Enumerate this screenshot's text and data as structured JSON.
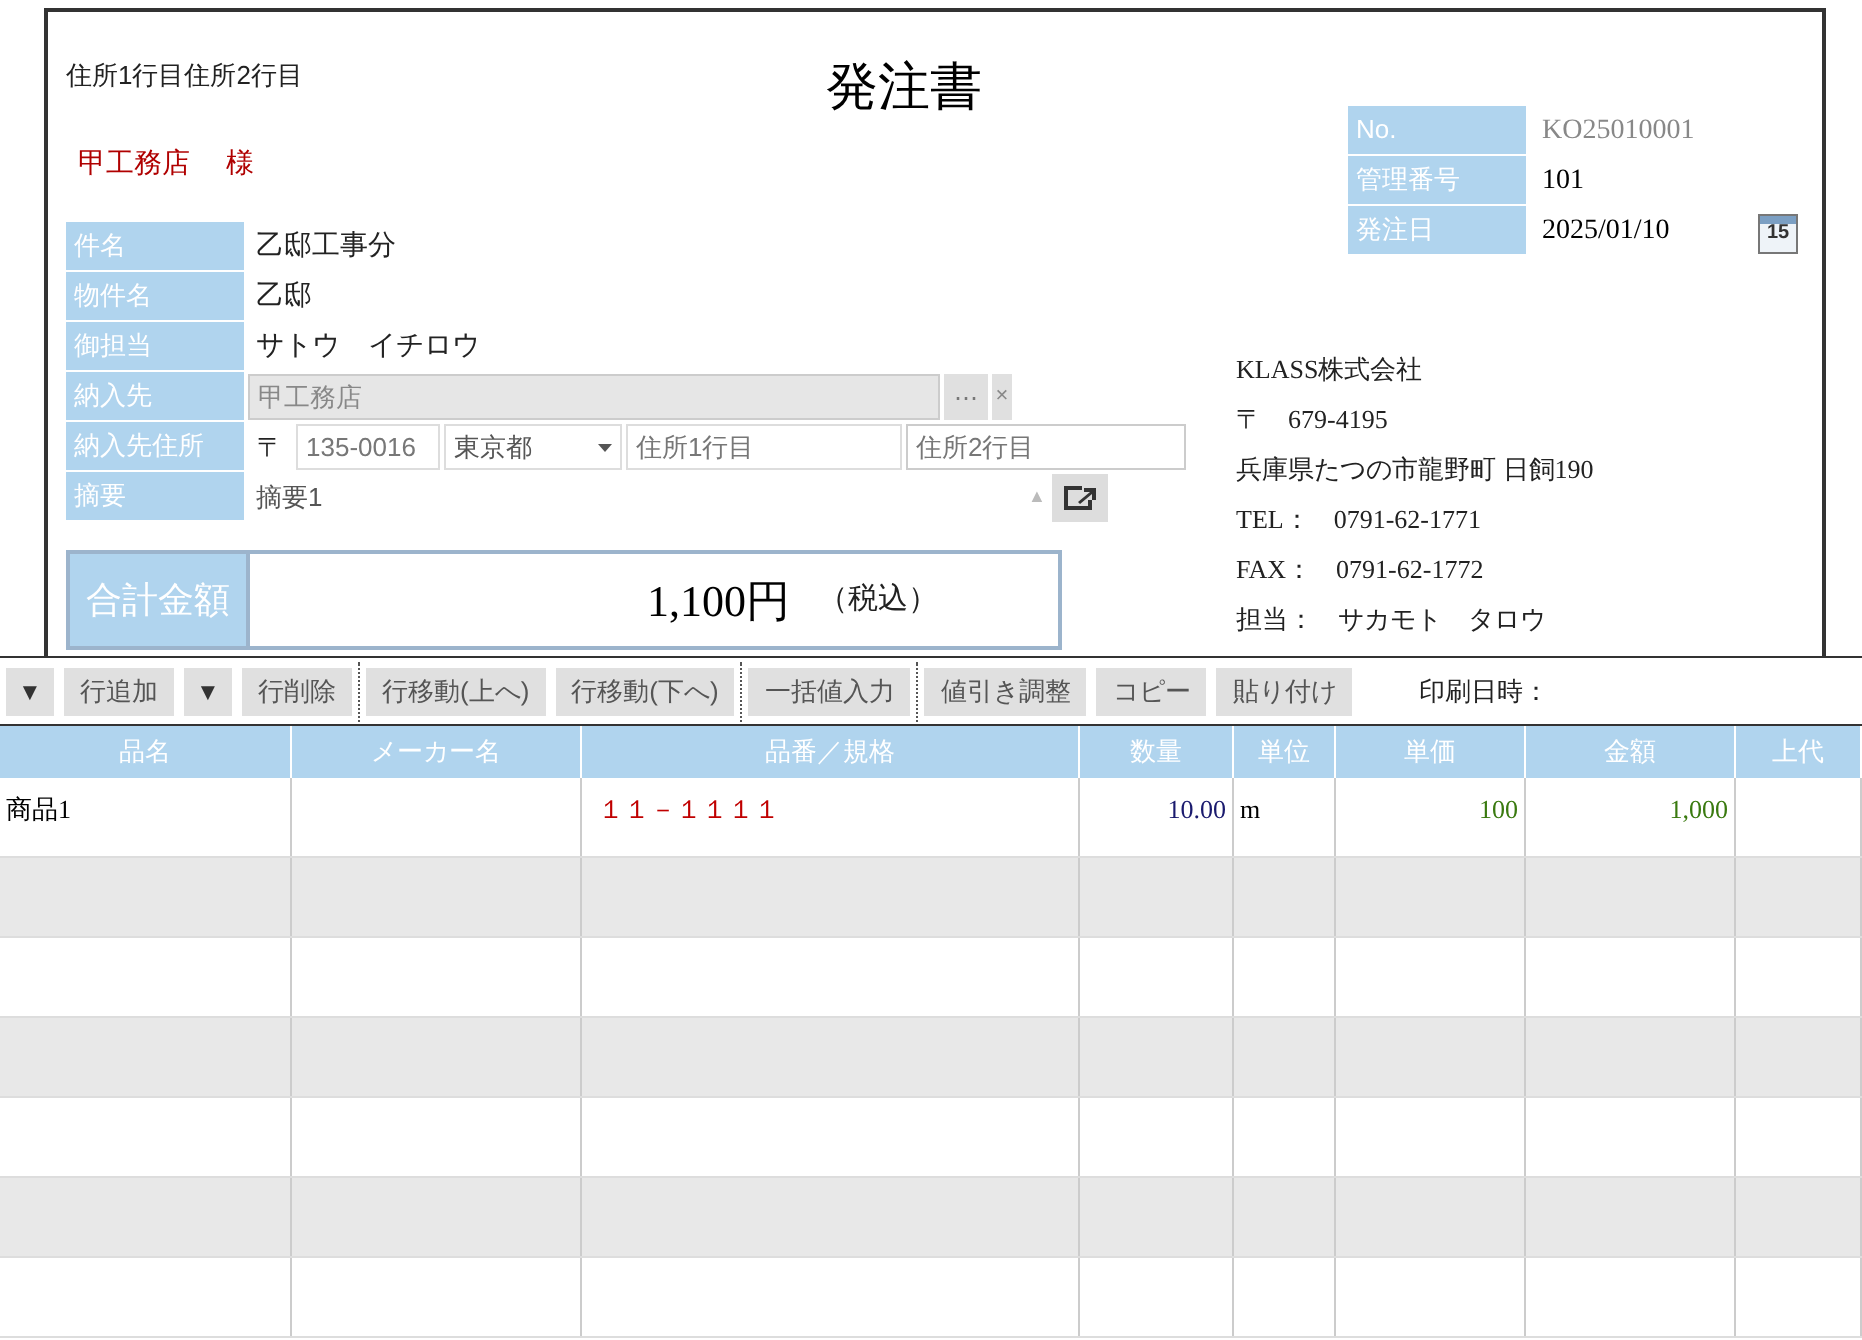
{
  "header": {
    "address_line": "住所1行目住所2行目",
    "title": "発注書",
    "customer": "甲工務店",
    "honorific": "様"
  },
  "fields": [
    {
      "kind": "text",
      "label": "件名",
      "value": "乙邸工事分"
    },
    {
      "kind": "text",
      "label": "物件名",
      "value": "乙邸"
    },
    {
      "kind": "text",
      "label": "御担当",
      "value": "サトウ　イチロウ"
    },
    {
      "kind": "lookup",
      "label": "納入先",
      "value": "甲工務店",
      "disabled": true,
      "browse": "⋯",
      "clear": "×"
    },
    {
      "kind": "address",
      "label": "納入先住所",
      "postal_mark": "〒",
      "zip": "135-0016",
      "prefecture": "東京都",
      "line1_placeholder": "住所1行目",
      "line2_placeholder": "住所2行目"
    },
    {
      "kind": "memo",
      "label": "摘要",
      "value": "摘要1",
      "scroll": "▲"
    }
  ],
  "total": {
    "label": "合計金額",
    "amount": "1,100円",
    "tax_note": "（税込）"
  },
  "order_info": [
    {
      "kind": "text",
      "label": "No.",
      "value": "KO25010001",
      "readonly": true
    },
    {
      "kind": "text",
      "label": "管理番号",
      "value": "101",
      "readonly": false
    },
    {
      "kind": "date",
      "label": "発注日",
      "value": "2025/01/10",
      "readonly": false,
      "calendar_day": "15"
    }
  ],
  "company": {
    "name": "KLASS株式会社",
    "postal": "〒　679-4195",
    "address": "兵庫県たつの市龍野町 日飼190",
    "tel_label": "TEL：",
    "tel": "0791-62-1771",
    "fax_label": "FAX：",
    "fax": "0791-62-1772",
    "contact_label": "担当：",
    "contact": "サカモト　タロウ"
  },
  "toolbar": {
    "groups": [
      [
        {
          "kind": "dropdown",
          "label": "▼"
        },
        {
          "kind": "button",
          "label": "行追加"
        },
        {
          "kind": "dropdown",
          "label": "▼"
        },
        {
          "kind": "button",
          "label": "行削除"
        }
      ],
      [
        {
          "kind": "button",
          "label": "行移動(上へ)"
        },
        {
          "kind": "button",
          "label": "行移動(下へ)"
        }
      ],
      [
        {
          "kind": "button",
          "label": "一括値入力"
        }
      ],
      [
        {
          "kind": "button",
          "label": "値引き調整"
        },
        {
          "kind": "button",
          "label": "コピー"
        },
        {
          "kind": "button",
          "label": "貼り付け"
        }
      ]
    ],
    "print_label": "印刷日時："
  },
  "table": {
    "columns": [
      "品名",
      "メーカー名",
      "品番／規格",
      "数量",
      "単位",
      "単価",
      "金額",
      "上代"
    ],
    "rows": [
      {
        "cells": [
          "商品1",
          "",
          "１１－１１１１",
          "10.00",
          "m",
          "100",
          "1,000",
          ""
        ]
      }
    ]
  }
}
